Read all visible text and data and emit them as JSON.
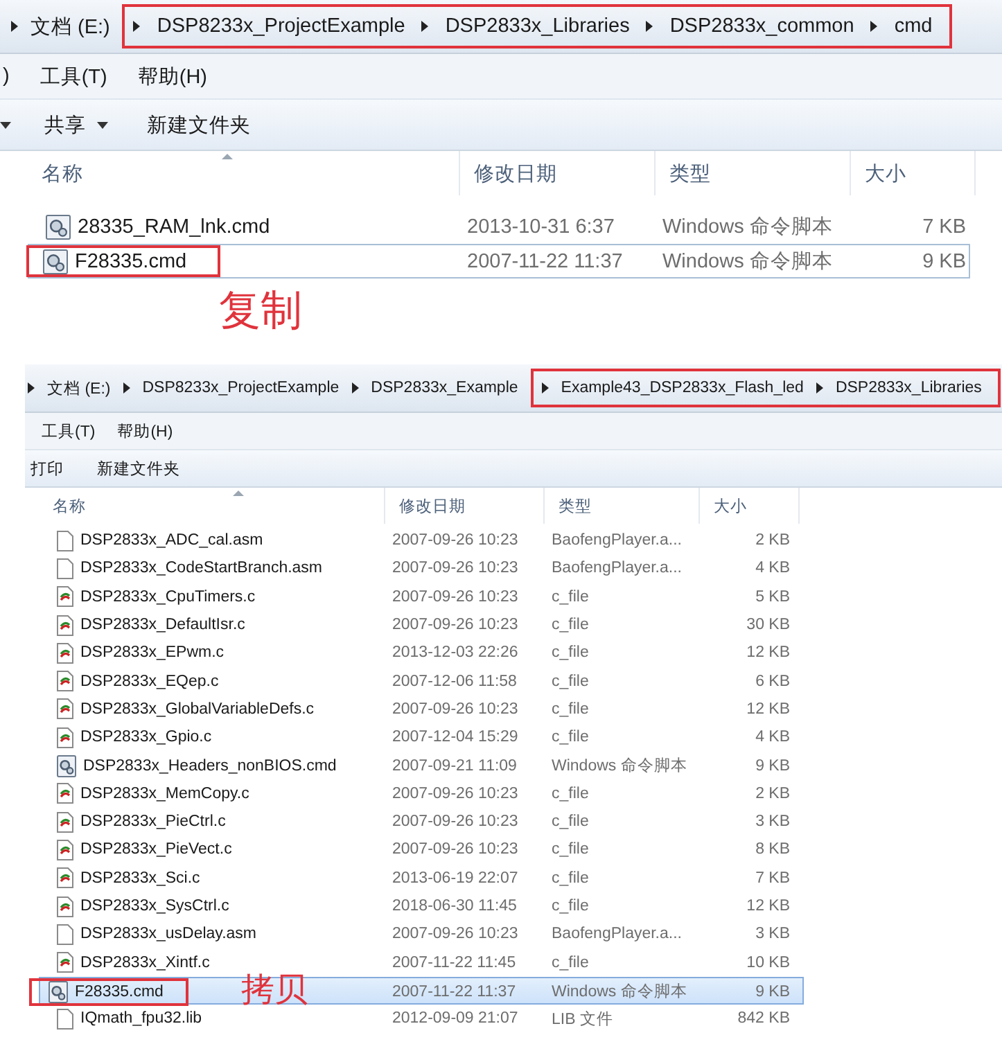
{
  "windows": [
    {
      "breadcrumb": [
        {
          "label": "文档 (E:)",
          "highlighted": false
        },
        {
          "label": "DSP8233x_ProjectExample",
          "highlighted": true
        },
        {
          "label": "DSP2833x_Libraries",
          "highlighted": true
        },
        {
          "label": "DSP2833x_common",
          "highlighted": true
        },
        {
          "label": "cmd",
          "highlighted": true
        }
      ],
      "menu": [
        ")",
        "工具(T)",
        "帮助(H)"
      ],
      "toolbar": [
        {
          "label": "共享",
          "has_caret": true
        },
        {
          "label": "新建文件夹",
          "has_caret": false
        }
      ],
      "toolbar_lead_caret": true,
      "columns": [
        "名称",
        "修改日期",
        "类型",
        "大小"
      ],
      "rows": [
        {
          "kind": "cmd",
          "name": "28335_RAM_lnk.cmd",
          "date": "2013-10-31 6:37",
          "type": "Windows 命令脚本",
          "size": "7 KB",
          "selected": false,
          "focused": false,
          "highlighted": false
        },
        {
          "kind": "cmd",
          "name": "F28335.cmd",
          "date": "2007-11-22 11:37",
          "type": "Windows 命令脚本",
          "size": "9 KB",
          "selected": false,
          "focused": true,
          "highlighted": true,
          "note": "复制"
        }
      ]
    },
    {
      "breadcrumb": [
        {
          "label": "文档 (E:)",
          "highlighted": false
        },
        {
          "label": "DSP8233x_ProjectExample",
          "highlighted": false
        },
        {
          "label": "DSP2833x_Example",
          "highlighted": false
        },
        {
          "label": "Example43_DSP2833x_Flash_led",
          "highlighted": true
        },
        {
          "label": "DSP2833x_Libraries",
          "highlighted": true
        }
      ],
      "menu": [
        "工具(T)",
        "帮助(H)"
      ],
      "toolbar": [
        {
          "label": "打印",
          "has_caret": false
        },
        {
          "label": "新建文件夹",
          "has_caret": false
        }
      ],
      "toolbar_lead_caret": false,
      "columns": [
        "名称",
        "修改日期",
        "类型",
        "大小"
      ],
      "rows": [
        {
          "kind": "blank",
          "name": "DSP2833x_ADC_cal.asm",
          "date": "2007-09-26 10:23",
          "type": "BaofengPlayer.a...",
          "size": "2 KB",
          "selected": false,
          "focused": false,
          "highlighted": false
        },
        {
          "kind": "blank",
          "name": "DSP2833x_CodeStartBranch.asm",
          "date": "2007-09-26 10:23",
          "type": "BaofengPlayer.a...",
          "size": "4 KB",
          "selected": false,
          "focused": false,
          "highlighted": false
        },
        {
          "kind": "c",
          "name": "DSP2833x_CpuTimers.c",
          "date": "2007-09-26 10:23",
          "type": "c_file",
          "size": "5 KB",
          "selected": false,
          "focused": false,
          "highlighted": false
        },
        {
          "kind": "c",
          "name": "DSP2833x_DefaultIsr.c",
          "date": "2007-09-26 10:23",
          "type": "c_file",
          "size": "30 KB",
          "selected": false,
          "focused": false,
          "highlighted": false
        },
        {
          "kind": "c",
          "name": "DSP2833x_EPwm.c",
          "date": "2013-12-03 22:26",
          "type": "c_file",
          "size": "12 KB",
          "selected": false,
          "focused": false,
          "highlighted": false
        },
        {
          "kind": "c",
          "name": "DSP2833x_EQep.c",
          "date": "2007-12-06 11:58",
          "type": "c_file",
          "size": "6 KB",
          "selected": false,
          "focused": false,
          "highlighted": false
        },
        {
          "kind": "c",
          "name": "DSP2833x_GlobalVariableDefs.c",
          "date": "2007-09-26 10:23",
          "type": "c_file",
          "size": "12 KB",
          "selected": false,
          "focused": false,
          "highlighted": false
        },
        {
          "kind": "c",
          "name": "DSP2833x_Gpio.c",
          "date": "2007-12-04 15:29",
          "type": "c_file",
          "size": "4 KB",
          "selected": false,
          "focused": false,
          "highlighted": false
        },
        {
          "kind": "cmd",
          "name": "DSP2833x_Headers_nonBIOS.cmd",
          "date": "2007-09-21 11:09",
          "type": "Windows 命令脚本",
          "size": "9 KB",
          "selected": false,
          "focused": false,
          "highlighted": false
        },
        {
          "kind": "c",
          "name": "DSP2833x_MemCopy.c",
          "date": "2007-09-26 10:23",
          "type": "c_file",
          "size": "2 KB",
          "selected": false,
          "focused": false,
          "highlighted": false
        },
        {
          "kind": "c",
          "name": "DSP2833x_PieCtrl.c",
          "date": "2007-09-26 10:23",
          "type": "c_file",
          "size": "3 KB",
          "selected": false,
          "focused": false,
          "highlighted": false
        },
        {
          "kind": "c",
          "name": "DSP2833x_PieVect.c",
          "date": "2007-09-26 10:23",
          "type": "c_file",
          "size": "8 KB",
          "selected": false,
          "focused": false,
          "highlighted": false
        },
        {
          "kind": "c",
          "name": "DSP2833x_Sci.c",
          "date": "2013-06-19 22:07",
          "type": "c_file",
          "size": "7 KB",
          "selected": false,
          "focused": false,
          "highlighted": false
        },
        {
          "kind": "c",
          "name": "DSP2833x_SysCtrl.c",
          "date": "2018-06-30 11:45",
          "type": "c_file",
          "size": "12 KB",
          "selected": false,
          "focused": false,
          "highlighted": false
        },
        {
          "kind": "blank",
          "name": "DSP2833x_usDelay.asm",
          "date": "2007-09-26 10:23",
          "type": "BaofengPlayer.a...",
          "size": "3 KB",
          "selected": false,
          "focused": false,
          "highlighted": false
        },
        {
          "kind": "c",
          "name": "DSP2833x_Xintf.c",
          "date": "2007-11-22 11:45",
          "type": "c_file",
          "size": "10 KB",
          "selected": false,
          "focused": false,
          "highlighted": false
        },
        {
          "kind": "cmd",
          "name": "F28335.cmd",
          "date": "2007-11-22 11:37",
          "type": "Windows 命令脚本",
          "size": "9 KB",
          "selected": true,
          "focused": false,
          "highlighted": true,
          "note": "拷贝"
        },
        {
          "kind": "blank",
          "name": "IQmath_fpu32.lib",
          "date": "2012-09-09 21:07",
          "type": "LIB 文件",
          "size": "842 KB",
          "selected": false,
          "focused": false,
          "highlighted": false
        }
      ]
    }
  ]
}
